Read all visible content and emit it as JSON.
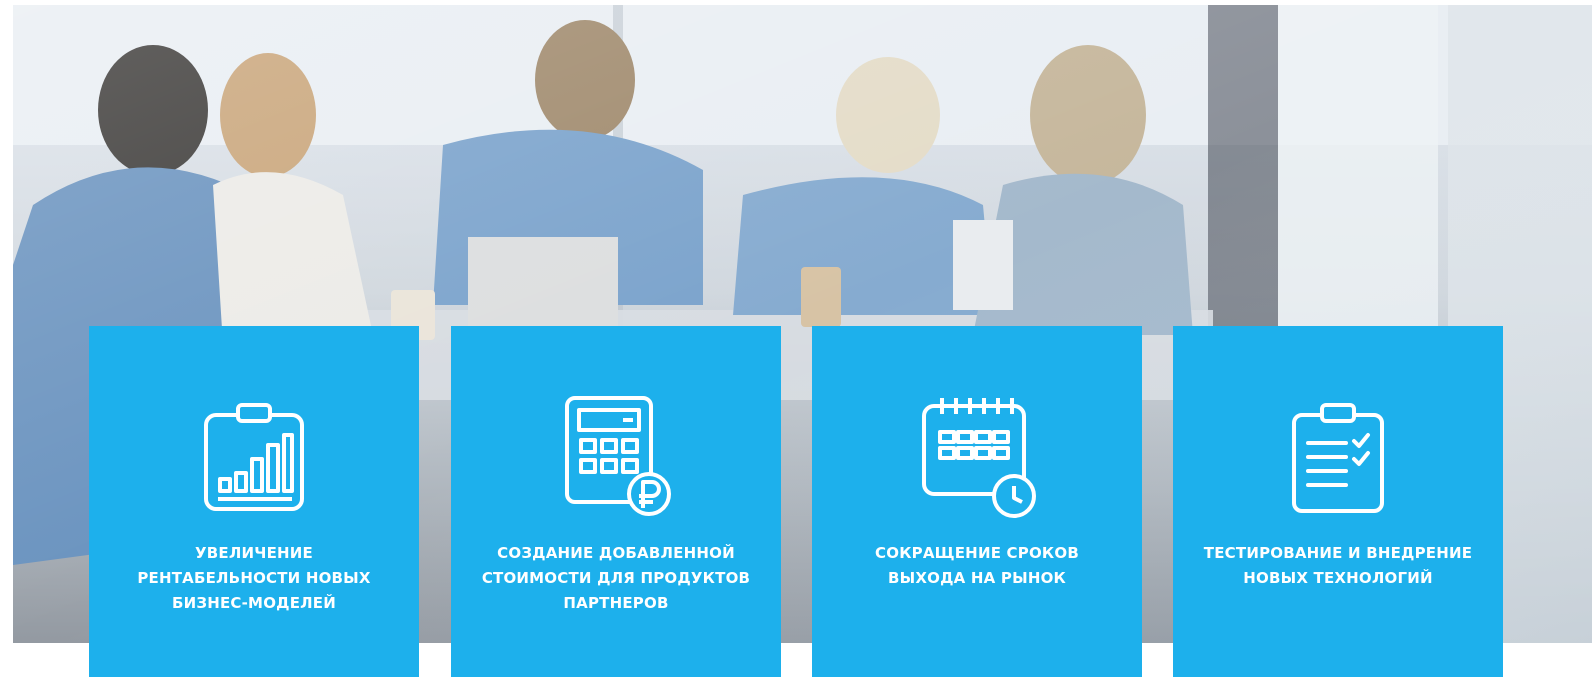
{
  "hero": {
    "image": "office-meeting-photo"
  },
  "cards": [
    {
      "icon": "clipboard-bar-chart-icon",
      "title": "УВЕЛИЧЕНИЕ\nРЕНТАБЕЛЬНОСТИ НОВЫХ\nБИЗНЕС-МОДЕЛЕЙ"
    },
    {
      "icon": "calculator-ruble-icon",
      "title": "СОЗДАНИЕ ДОБАВЛЕННОЙ\nСТОИМОСТИ ДЛЯ ПРОДУКТОВ\nПАРТНЕРОВ"
    },
    {
      "icon": "calendar-clock-icon",
      "title": "СОКРАЩЕНИЕ СРОКОВ\nВЫХОДА НА РЫНОК"
    },
    {
      "icon": "clipboard-checklist-icon",
      "title": "ТЕСТИРОВАНИЕ И ВНЕДРЕНИЕ\nНОВЫХ ТЕХНОЛОГИЙ"
    }
  ],
  "colors": {
    "card_background": "#1db0ec",
    "card_text": "#ffffff"
  }
}
